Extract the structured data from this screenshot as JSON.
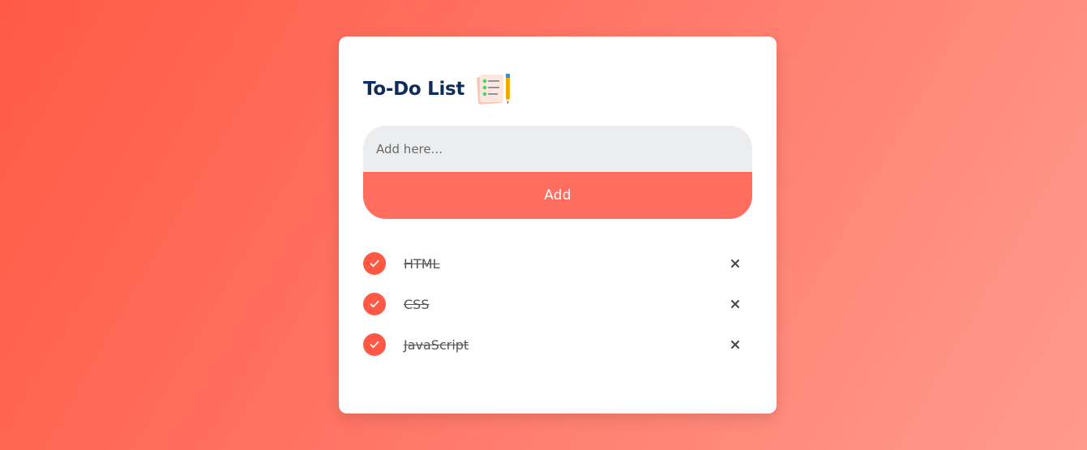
{
  "app": {
    "title": "To-Do List",
    "title_icon": "notepad-pencil-icon"
  },
  "input": {
    "placeholder": "Add here...",
    "value": ""
  },
  "add_button": {
    "label": "Add"
  },
  "colors": {
    "accent": "#ff5945",
    "button": "#ff6e5f",
    "title": "#0f2d5c",
    "input_bg": "#ecedee"
  },
  "tasks": [
    {
      "label": "HTML",
      "completed": true
    },
    {
      "label": "CSS",
      "completed": true
    },
    {
      "label": "JavaScript",
      "completed": true
    }
  ],
  "icons": {
    "check": "check-icon",
    "delete": "close-icon"
  }
}
